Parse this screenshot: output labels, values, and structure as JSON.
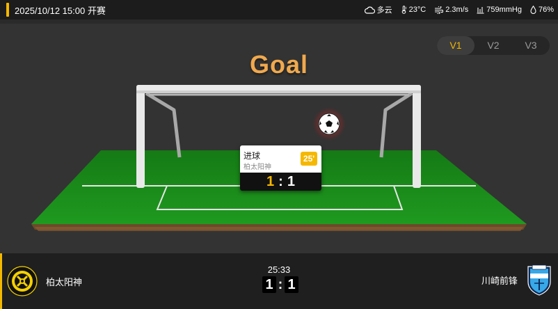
{
  "header": {
    "match_time": "2025/10/12 15:00 开赛",
    "weather": [
      {
        "icon": "cloudy-icon",
        "text": "多云"
      },
      {
        "icon": "thermometer-icon",
        "text": "23°C"
      },
      {
        "icon": "wind-icon",
        "text": "2.3m/s"
      },
      {
        "icon": "pressure-icon",
        "text": "759mmHg"
      },
      {
        "icon": "humidity-icon",
        "text": "76%"
      }
    ]
  },
  "versions": [
    "V1",
    "V2",
    "V3"
  ],
  "active_version": "V1",
  "animation": {
    "title": "Goal",
    "event": {
      "type": "进球",
      "team": "柏太阳神",
      "minute": "25'",
      "score_home": "1",
      "score_sep": ":",
      "score_away": "1"
    }
  },
  "scoreboard": {
    "home_team": "柏太阳神",
    "away_team": "川崎前锋",
    "clock": "25:33",
    "home_score": "1",
    "sep": ":",
    "away_score": "1"
  },
  "colors": {
    "accent": "#f5b800",
    "pitch": "#1e8a1e",
    "background": "#333333"
  }
}
